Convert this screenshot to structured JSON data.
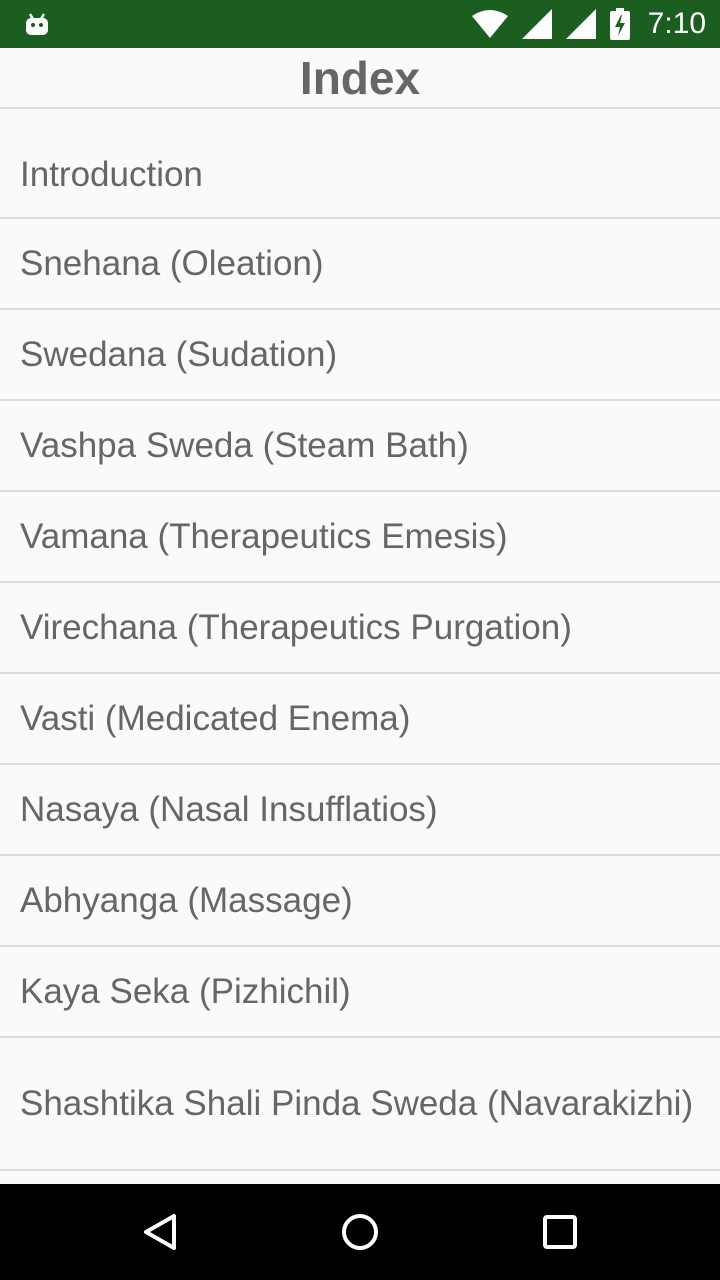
{
  "status_bar": {
    "time": "7:10",
    "icons": [
      "android-icon",
      "wifi-icon",
      "signal-icon",
      "signal-icon-2",
      "battery-charging-icon"
    ],
    "background_color": "#1b5e20"
  },
  "header": {
    "title": "Index"
  },
  "list": {
    "items": [
      {
        "label": "Introduction"
      },
      {
        "label": "Snehana (Oleation)"
      },
      {
        "label": "Swedana (Sudation)"
      },
      {
        "label": "Vashpa Sweda (Steam Bath)"
      },
      {
        "label": "Vamana (Therapeutics Emesis)"
      },
      {
        "label": "Virechana (Therapeutics Purgation)"
      },
      {
        "label": "Vasti (Medicated Enema)"
      },
      {
        "label": "Nasaya (Nasal Insufflatios)"
      },
      {
        "label": "Abhyanga (Massage)"
      },
      {
        "label": "Kaya Seka (Pizhichil)"
      },
      {
        "label": "Shashtika Shali Pinda Sweda (Navarakizhi)"
      }
    ]
  },
  "nav_bar": {
    "buttons": [
      "back-icon",
      "home-icon",
      "recents-icon"
    ]
  }
}
